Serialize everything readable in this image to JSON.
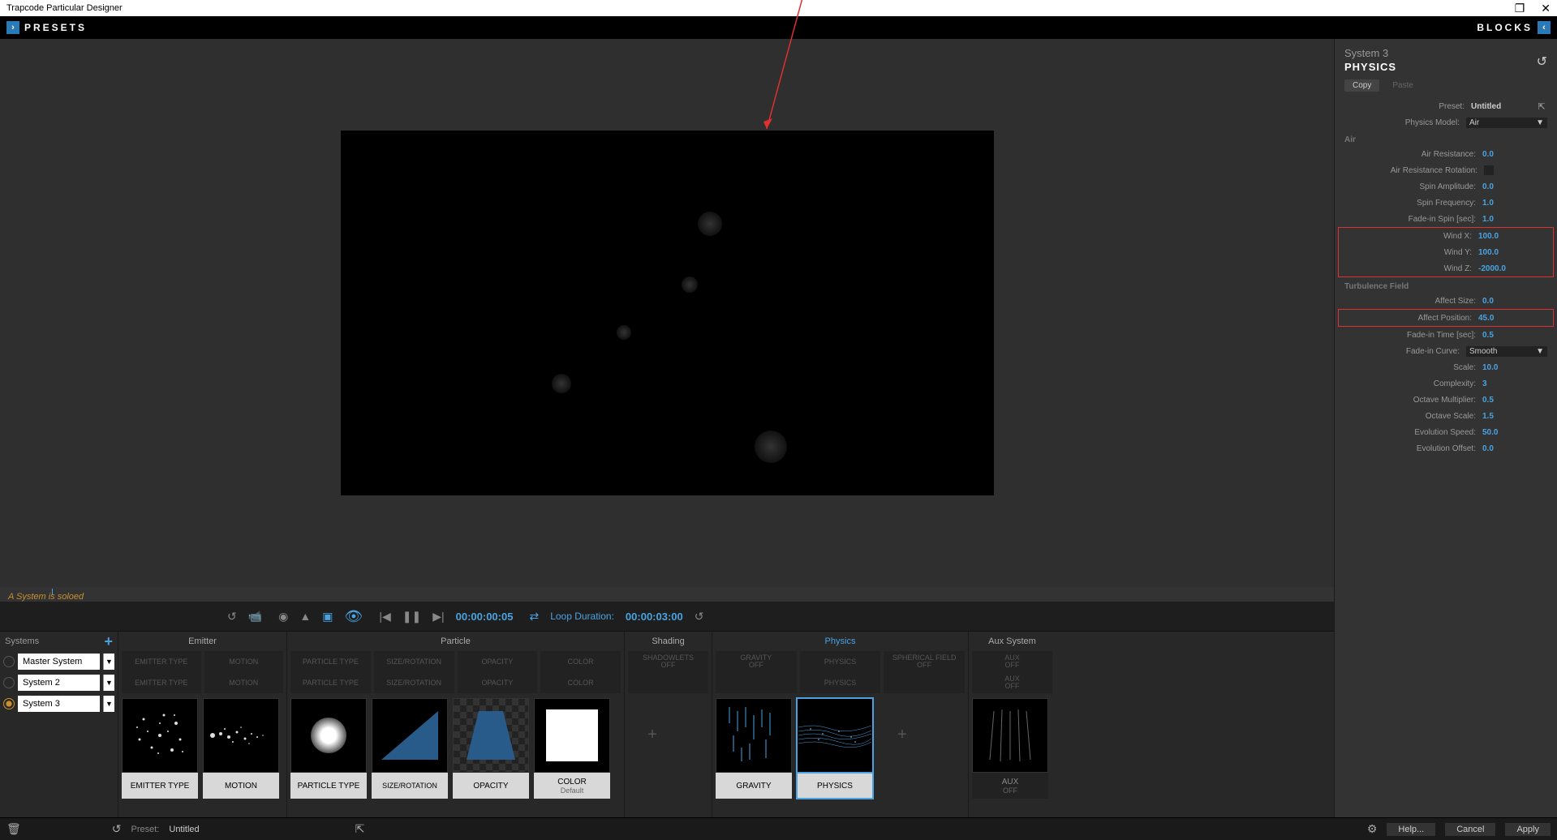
{
  "title": "Trapcode Particular Designer",
  "header": {
    "presets": "PRESETS",
    "blocks": "BLOCKS"
  },
  "status": "A System is soloed",
  "transport": {
    "timecode": "00:00:00:05",
    "loop_label": "Loop Duration:",
    "loop_value": "00:00:03:00"
  },
  "systems": {
    "header": "Systems",
    "items": [
      {
        "name": "Master System",
        "solo": false
      },
      {
        "name": "System 2",
        "solo": false
      },
      {
        "name": "System 3",
        "solo": true
      }
    ]
  },
  "block_sections": {
    "emitter": "Emitter",
    "particle": "Particle",
    "shading": "Shading",
    "physics": "Physics",
    "aux": "Aux System"
  },
  "slots": {
    "emitter_type": "EMITTER TYPE",
    "motion": "MOTION",
    "particle_type": "PARTICLE TYPE",
    "size_rotation": "SIZE/ROTATION",
    "opacity": "OPACITY",
    "color": "COLOR",
    "shadowlets": "SHADOWLETS\nOFF",
    "gravity": "GRAVITY\nOFF",
    "physics": "PHYSICS",
    "spherical": "SPHERICAL FIELD\nOFF",
    "aux": "AUX\nOFF"
  },
  "cards": {
    "emitter_type": "EMITTER TYPE",
    "motion": "MOTION",
    "particle_type": "PARTICLE TYPE",
    "size_rotation": "SIZE/ROTATION",
    "opacity": "OPACITY",
    "color": "COLOR",
    "color_sub": "Default",
    "gravity": "GRAVITY",
    "physics": "PHYSICS",
    "aux": "AUX",
    "aux_sub": "OFF"
  },
  "props": {
    "system": "System 3",
    "title": "PHYSICS",
    "copy": "Copy",
    "paste": "Paste",
    "preset_label": "Preset:",
    "preset_value": "Untitled",
    "physics_model_label": "Physics Model:",
    "physics_model_value": "Air",
    "section_air": "Air",
    "air_resistance_label": "Air Resistance:",
    "air_resistance_value": "0.0",
    "air_res_rot_label": "Air Resistance Rotation:",
    "spin_amp_label": "Spin Amplitude:",
    "spin_amp_value": "0.0",
    "spin_freq_label": "Spin Frequency:",
    "spin_freq_value": "1.0",
    "fade_spin_label": "Fade-in Spin [sec]:",
    "fade_spin_value": "1.0",
    "wind_x_label": "Wind X:",
    "wind_x_value": "100.0",
    "wind_y_label": "Wind Y:",
    "wind_y_value": "100.0",
    "wind_z_label": "Wind Z:",
    "wind_z_value": "-2000.0",
    "section_turb": "Turbulence Field",
    "affect_size_label": "Affect Size:",
    "affect_size_value": "0.0",
    "affect_pos_label": "Affect Position:",
    "affect_pos_value": "45.0",
    "fade_time_label": "Fade-in Time [sec]:",
    "fade_time_value": "0.5",
    "fade_curve_label": "Fade-in Curve:",
    "fade_curve_value": "Smooth",
    "scale_label": "Scale:",
    "scale_value": "10.0",
    "complexity_label": "Complexity:",
    "complexity_value": "3",
    "octave_mult_label": "Octave Multiplier:",
    "octave_mult_value": "0.5",
    "octave_scale_label": "Octave Scale:",
    "octave_scale_value": "1.5",
    "evo_speed_label": "Evolution Speed:",
    "evo_speed_value": "50.0",
    "evo_offset_label": "Evolution Offset:",
    "evo_offset_value": "0.0"
  },
  "footer": {
    "preset_label": "Preset:",
    "preset_value": "Untitled",
    "help": "Help...",
    "cancel": "Cancel",
    "apply": "Apply"
  }
}
